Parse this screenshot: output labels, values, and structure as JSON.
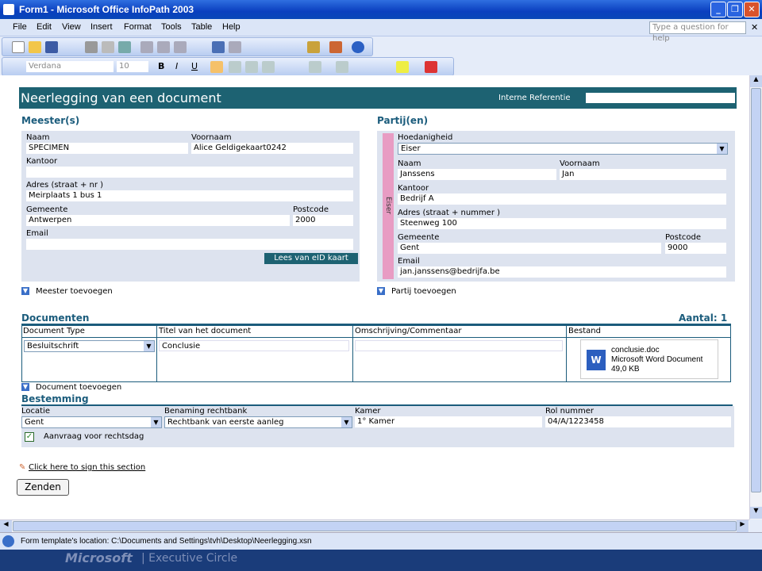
{
  "window": {
    "title": "Form1 - Microsoft Office InfoPath 2003"
  },
  "menu": [
    "File",
    "Edit",
    "View",
    "Insert",
    "Format",
    "Tools",
    "Table",
    "Help"
  ],
  "ask": "Type a question for help",
  "formatbar": {
    "font": "Verdana",
    "size": "10"
  },
  "form": {
    "title": "Neerlegging van een document",
    "ref_label": "Interne Referentie",
    "meester": {
      "heading": "Meester(s)",
      "naam_l": "Naam",
      "naam": "SPECIMEN",
      "voornaam_l": "Voornaam",
      "voornaam": "Alice Geldigekaart0242",
      "kantoor_l": "Kantoor",
      "adres_l": "Adres (straat + nr )",
      "adres": "Meirplaats 1 bus 1",
      "gemeente_l": "Gemeente",
      "gemeente": "Antwerpen",
      "postcode_l": "Postcode",
      "postcode": "2000",
      "email_l": "Email",
      "eid": "Lees van eID kaart",
      "add": "Meester toevoegen"
    },
    "partij": {
      "heading": "Partij(en)",
      "side": "Eiser",
      "hoed_l": "Hoedanigheid",
      "hoed": "Eiser",
      "naam_l": "Naam",
      "naam": "Janssens",
      "voornaam_l": "Voornaam",
      "voornaam": "Jan",
      "kantoor_l": "Kantoor",
      "kantoor": "Bedrijf A",
      "adres_l": "Adres (straat + nummer )",
      "adres": "Steenweg 100",
      "gemeente_l": "Gemeente",
      "gemeente": "Gent",
      "postcode_l": "Postcode",
      "postcode": "9000",
      "email_l": "Email",
      "email": "jan.janssens@bedrijfa.be",
      "add": "Partij toevoegen"
    },
    "docs": {
      "heading": "Documenten",
      "count": "Aantal: 1",
      "cols": [
        "Document Type",
        "Titel van het document",
        "Omschrijving/Commentaar",
        "Bestand"
      ],
      "type": "Besluitschrift",
      "titel": "Conclusie",
      "file_name": "conclusie.doc",
      "file_type": "Microsoft Word Document",
      "file_size": "49,0 KB",
      "add": "Document toevoegen"
    },
    "best": {
      "heading": "Bestemming",
      "locatie_l": "Locatie",
      "locatie": "Gent",
      "rb_l": "Benaming rechtbank",
      "rb": "Rechtbank van eerste aanleg",
      "kamer_l": "Kamer",
      "kamer": "1° Kamer",
      "rol_l": "Rol nummer",
      "rol": "04/A/1223458",
      "check": "Aanvraag voor rechtsdag"
    },
    "sign": "Click here to sign this section",
    "submit": "Zenden"
  },
  "status": "Form template's location: C:\\Documents and Settings\\tvh\\Desktop\\Neerlegging.xsn",
  "taskbar": {
    "brand": "Microsoft",
    "text": "| Executive Circle"
  },
  "colors": {
    "header": "#1d6272",
    "accent": "#1b5c7c",
    "side": "#e89cc3"
  }
}
